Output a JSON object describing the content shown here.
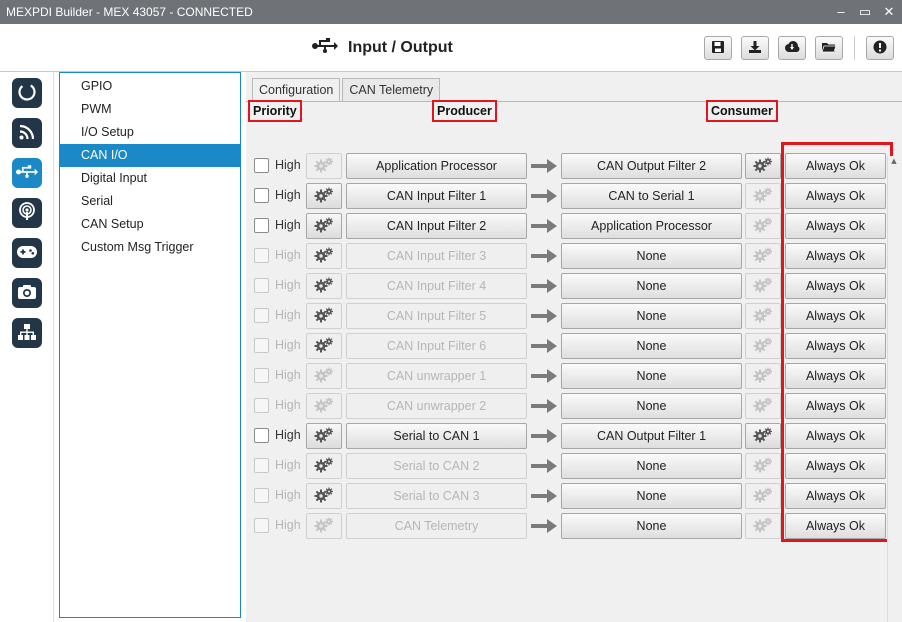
{
  "window": {
    "title": "MEXPDI Builder - MEX 43057 - CONNECTED",
    "controls": [
      "–",
      "▭",
      "✕"
    ]
  },
  "header": {
    "title": "Input / Output",
    "icon": "usb-icon",
    "actions": [
      {
        "name": "save-button",
        "icon": "floppy-icon"
      },
      {
        "name": "download-button",
        "icon": "download-icon"
      },
      {
        "name": "cloud-download-button",
        "icon": "cloud-download-icon"
      },
      {
        "name": "open-folder-button",
        "icon": "folder-icon"
      },
      {
        "name": "info-button",
        "icon": "info-icon"
      }
    ]
  },
  "rail": [
    {
      "name": "status-icon",
      "active": false
    },
    {
      "name": "rss-icon",
      "active": false
    },
    {
      "name": "usb-icon",
      "active": true
    },
    {
      "name": "podcast-icon",
      "active": false
    },
    {
      "name": "gamepad-icon",
      "active": false
    },
    {
      "name": "camera-icon",
      "active": false
    },
    {
      "name": "sitemap-icon",
      "active": false
    }
  ],
  "nav": {
    "items": [
      {
        "label": "GPIO",
        "selected": false
      },
      {
        "label": "PWM",
        "selected": false
      },
      {
        "label": "I/O Setup",
        "selected": false
      },
      {
        "label": "CAN I/O",
        "selected": true
      },
      {
        "label": "Digital Input",
        "selected": false
      },
      {
        "label": "Serial",
        "selected": false
      },
      {
        "label": "CAN Setup",
        "selected": false
      },
      {
        "label": "Custom Msg Trigger",
        "selected": false
      }
    ]
  },
  "tabs": [
    {
      "label": "Configuration",
      "active": true
    },
    {
      "label": "CAN Telemetry",
      "active": false
    }
  ],
  "columns": {
    "priority": "Priority",
    "producer": "Producer",
    "consumer": "Consumer"
  },
  "rows": [
    {
      "priority_label": "High",
      "producer": "Application Processor",
      "consumer": "CAN Output Filter 2",
      "status": "Always Ok",
      "enabled": true,
      "producer_gear": false,
      "consumer_gear": true
    },
    {
      "priority_label": "High",
      "producer": "CAN Input Filter 1",
      "consumer": "CAN to Serial 1",
      "status": "Always Ok",
      "enabled": true,
      "producer_gear": true,
      "consumer_gear": false
    },
    {
      "priority_label": "High",
      "producer": "CAN Input Filter 2",
      "consumer": "Application Processor",
      "status": "Always Ok",
      "enabled": true,
      "producer_gear": true,
      "consumer_gear": false
    },
    {
      "priority_label": "High",
      "producer": "CAN Input Filter 3",
      "consumer": "None",
      "status": "Always Ok",
      "enabled": false,
      "producer_gear": true,
      "consumer_gear": false
    },
    {
      "priority_label": "High",
      "producer": "CAN Input Filter 4",
      "consumer": "None",
      "status": "Always Ok",
      "enabled": false,
      "producer_gear": true,
      "consumer_gear": false
    },
    {
      "priority_label": "High",
      "producer": "CAN Input Filter 5",
      "consumer": "None",
      "status": "Always Ok",
      "enabled": false,
      "producer_gear": true,
      "consumer_gear": false
    },
    {
      "priority_label": "High",
      "producer": "CAN Input Filter 6",
      "consumer": "None",
      "status": "Always Ok",
      "enabled": false,
      "producer_gear": true,
      "consumer_gear": false
    },
    {
      "priority_label": "High",
      "producer": "CAN unwrapper 1",
      "consumer": "None",
      "status": "Always Ok",
      "enabled": false,
      "producer_gear": false,
      "consumer_gear": false
    },
    {
      "priority_label": "High",
      "producer": "CAN unwrapper 2",
      "consumer": "None",
      "status": "Always Ok",
      "enabled": false,
      "producer_gear": false,
      "consumer_gear": false
    },
    {
      "priority_label": "High",
      "producer": "Serial to CAN 1",
      "consumer": "CAN Output Filter 1",
      "status": "Always Ok",
      "enabled": true,
      "producer_gear": true,
      "consumer_gear": true
    },
    {
      "priority_label": "High",
      "producer": "Serial to CAN 2",
      "consumer": "None",
      "status": "Always Ok",
      "enabled": false,
      "producer_gear": true,
      "consumer_gear": false
    },
    {
      "priority_label": "High",
      "producer": "Serial to CAN 3",
      "consumer": "None",
      "status": "Always Ok",
      "enabled": false,
      "producer_gear": true,
      "consumer_gear": false
    },
    {
      "priority_label": "High",
      "producer": "CAN Telemetry",
      "consumer": "None",
      "status": "Always Ok",
      "enabled": false,
      "producer_gear": false,
      "consumer_gear": false
    }
  ],
  "scrollbar": {
    "up": "▲",
    "down": "▼"
  }
}
